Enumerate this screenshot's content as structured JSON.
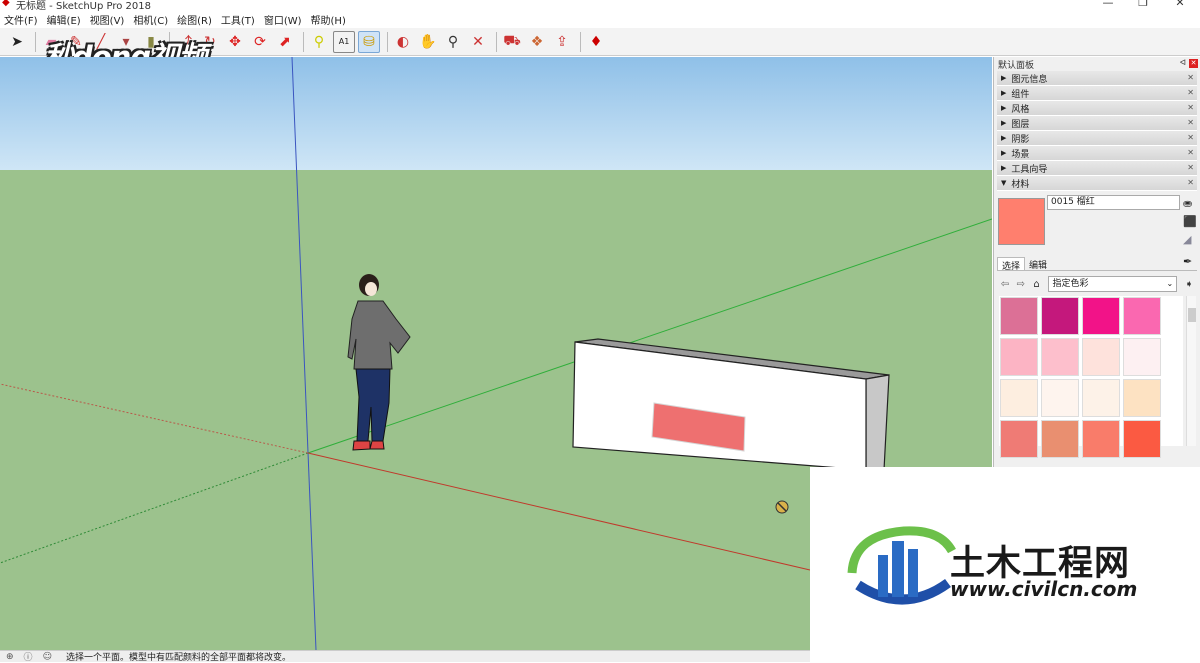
{
  "window": {
    "title": "无标题 - SketchUp Pro 2018",
    "minimize": "—",
    "maximize": "❐",
    "close": "✕"
  },
  "menu": [
    "文件(F)",
    "编辑(E)",
    "视图(V)",
    "相机(C)",
    "绘图(R)",
    "工具(T)",
    "窗口(W)",
    "帮助(H)"
  ],
  "toolbar": {
    "tools": [
      "select-arrow-icon",
      "eraser-icon",
      "paint-bucket-icon",
      "line-icon",
      "rectangle-icon",
      "push-pull-icon",
      "offset-icon",
      "move-icon",
      "rotate-icon",
      "scale-icon",
      "tape-measure-icon",
      "text-icon",
      "paint-bucket-active-icon",
      "orbit-icon",
      "pan-icon",
      "zoom-icon",
      "zoom-extents-icon",
      "warehouse-icon",
      "extension-icon",
      "share-model-icon",
      "ruby-icon"
    ],
    "text_tool_label": "A1"
  },
  "watermark_top": "秒dong视频",
  "panel": {
    "title": "默认面板",
    "pin": "ᐊ",
    "close": "✕",
    "trays": [
      {
        "label": "图元信息",
        "expanded": false
      },
      {
        "label": "组件",
        "expanded": false
      },
      {
        "label": "风格",
        "expanded": false
      },
      {
        "label": "图层",
        "expanded": false
      },
      {
        "label": "阴影",
        "expanded": false
      },
      {
        "label": "场景",
        "expanded": false
      },
      {
        "label": "工具向导",
        "expanded": false
      },
      {
        "label": "材料",
        "expanded": true
      }
    ],
    "materials": {
      "current_name": "0015 榴红",
      "current_color": "#ff7f6e",
      "tabs": [
        "选择",
        "编辑"
      ],
      "collection": "指定色彩",
      "swatches": [
        "#dc7096",
        "#c4187c",
        "#f21388",
        "#fa68b0",
        "#fcb4c4",
        "#fdbfcc",
        "#fee2dc",
        "#fdf0f2",
        "#fdeee0",
        "#fef4ee",
        "#fdf2e8",
        "#fde2c2",
        "#ef7b75",
        "#e98f70",
        "#f97c6a",
        "#fb5a42"
      ]
    }
  },
  "status": {
    "text": "选择一个平面。模型中有匹配颜料的全部平面都将改变。"
  },
  "logo": {
    "name_cn": "土木工程网",
    "url": "www.civilcn.com"
  }
}
